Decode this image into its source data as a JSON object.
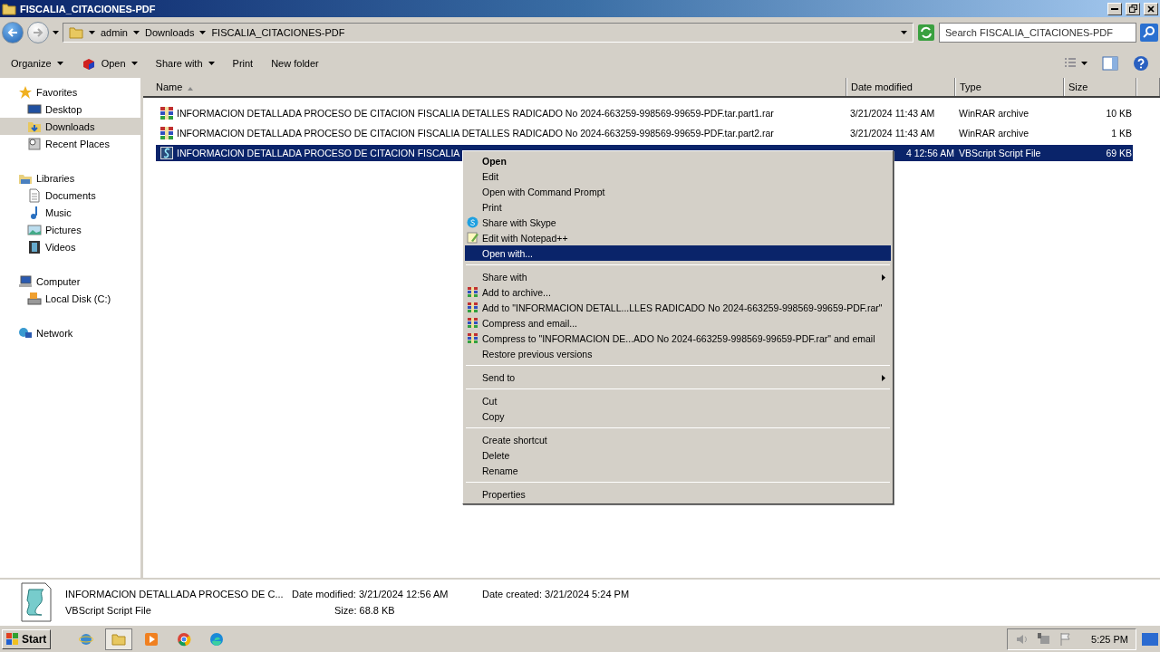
{
  "window": {
    "title": "FISCALIA_CITACIONES-PDF"
  },
  "address": {
    "crumbs": [
      "admin",
      "Downloads",
      "FISCALIA_CITACIONES-PDF"
    ],
    "search_placeholder": "Search FISCALIA_CITACIONES-PDF"
  },
  "toolbar": [
    {
      "label": "Organize",
      "dropdown": true
    },
    {
      "label": "Open",
      "dropdown": true
    },
    {
      "label": "Share with",
      "dropdown": true
    },
    {
      "label": "Print",
      "dropdown": false
    },
    {
      "label": "New folder",
      "dropdown": false
    }
  ],
  "sidebar": [
    {
      "label": "Favorites",
      "selected": false,
      "children": [
        {
          "label": "Desktop",
          "selected": false
        },
        {
          "label": "Downloads",
          "selected": true
        },
        {
          "label": "Recent Places",
          "selected": false
        }
      ]
    },
    {
      "label": "Libraries",
      "selected": false,
      "children": [
        {
          "label": "Documents",
          "selected": false
        },
        {
          "label": "Music",
          "selected": false
        },
        {
          "label": "Pictures",
          "selected": false
        },
        {
          "label": "Videos",
          "selected": false
        }
      ]
    },
    {
      "label": "Computer",
      "selected": false,
      "children": [
        {
          "label": "Local Disk (C:)",
          "selected": false
        }
      ]
    },
    {
      "label": "Network",
      "selected": false
    }
  ],
  "table": {
    "columns": [
      "Name",
      "Date modified",
      "Type",
      "Size"
    ],
    "rows": [
      {
        "kind": "rar",
        "selected": false,
        "name": "INFORMACION DETALLADA PROCESO DE CITACION FISCALIA DETALLES RADICADO No 2024-663259-998569-99659-PDF.tar.part1.rar",
        "date": "3/21/2024 11:43 AM",
        "type": "WinRAR archive",
        "size": "10 KB"
      },
      {
        "kind": "rar",
        "selected": false,
        "name": "INFORMACION DETALLADA PROCESO DE CITACION FISCALIA DETALLES RADICADO No 2024-663259-998569-99659-PDF.tar.part2.rar",
        "date": "3/21/2024 11:43 AM",
        "type": "WinRAR archive",
        "size": "1 KB"
      },
      {
        "kind": "script",
        "selected": true,
        "name": "INFORMACION DETALLADA PROCESO DE CITACION FISCALIA",
        "date": "4 12:56 AM",
        "type": "VBScript Script File",
        "size": "69 KB"
      }
    ]
  },
  "context_menu": [
    {
      "kind": "item",
      "label": "Open",
      "default": true,
      "selected": false
    },
    {
      "kind": "item",
      "label": "Edit",
      "selected": false
    },
    {
      "kind": "item",
      "label": "Open with Command Prompt",
      "selected": false
    },
    {
      "kind": "item",
      "label": "Print",
      "selected": false
    },
    {
      "kind": "item",
      "label": "Share with Skype",
      "selected": false
    },
    {
      "kind": "item",
      "label": "Edit with Notepad++",
      "selected": false
    },
    {
      "kind": "item",
      "label": "Open with...",
      "selected": true
    },
    {
      "kind": "separator"
    },
    {
      "kind": "submenu",
      "label": "Share with",
      "selected": false
    },
    {
      "kind": "item",
      "label": "Add to archive...",
      "selected": false
    },
    {
      "kind": "item",
      "label": "Add to \"INFORMACION DETALL...LLES RADICADO No 2024-663259-998569-99659-PDF.rar\"",
      "selected": false
    },
    {
      "kind": "item",
      "label": "Compress and email...",
      "selected": false
    },
    {
      "kind": "item",
      "label": "Compress to \"INFORMACION DE...ADO No 2024-663259-998569-99659-PDF.rar\" and email",
      "selected": false
    },
    {
      "kind": "item",
      "label": "Restore previous versions",
      "selected": false
    },
    {
      "kind": "separator"
    },
    {
      "kind": "submenu",
      "label": "Send to",
      "selected": false
    },
    {
      "kind": "separator"
    },
    {
      "kind": "item",
      "label": "Cut",
      "selected": false
    },
    {
      "kind": "item",
      "label": "Copy",
      "selected": false
    },
    {
      "kind": "separator"
    },
    {
      "kind": "item",
      "label": "Create shortcut",
      "selected": false
    },
    {
      "kind": "item",
      "label": "Delete",
      "selected": false
    },
    {
      "kind": "item",
      "label": "Rename",
      "selected": false
    },
    {
      "kind": "separator"
    },
    {
      "kind": "item",
      "label": "Properties",
      "selected": false
    }
  ],
  "details": {
    "name": "INFORMACION DETALLADA PROCESO DE C...",
    "type": "VBScript Script File",
    "fields": [
      {
        "label": "Date modified:",
        "value": "3/21/2024 12:56 AM"
      },
      {
        "label": "Date created:",
        "value": "3/21/2024 5:24 PM"
      },
      {
        "label": "Size:",
        "value": "68.8 KB"
      }
    ]
  },
  "taskbar": {
    "start": "Start",
    "apps": [
      {
        "selected": false
      },
      {
        "selected": true
      },
      {
        "selected": false
      },
      {
        "selected": false
      },
      {
        "selected": false
      }
    ],
    "clock": "5:25 PM"
  }
}
